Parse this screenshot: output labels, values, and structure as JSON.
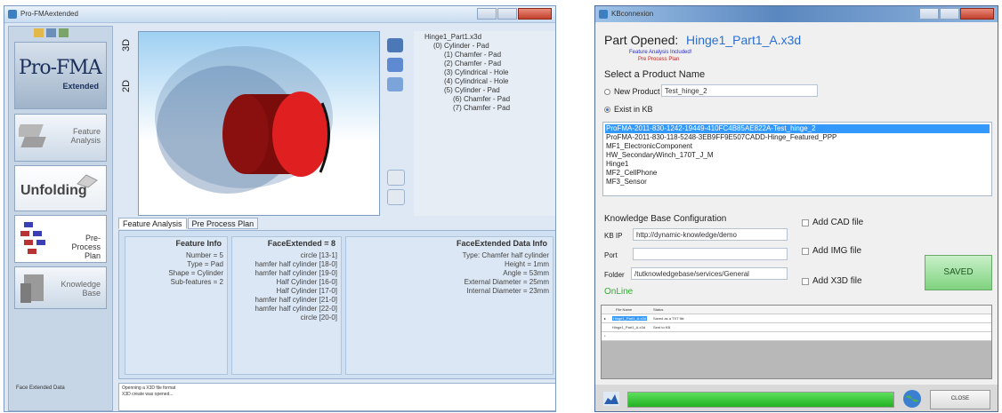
{
  "left_window": {
    "title": "Pro-FMAextended",
    "logo_main": "Pro-FMA",
    "logo_sub": "Extended",
    "side_buttons": [
      {
        "label": "Feature Analysis"
      },
      {
        "label": "Unfolding"
      },
      {
        "label": "Pre-Process Plan"
      },
      {
        "label": "Knowledge Base"
      }
    ],
    "side_status": "Face Extended Data",
    "view_tabs": [
      "3D",
      "2D"
    ],
    "tree": [
      "Hinge1_Part1.x3d",
      "(0) Cylinder - Pad",
      "(1) Chamfer - Pad",
      "(2) Chamfer - Pad",
      "(3) Cylindrical - Hole",
      "(4) Cylindrical - Hole",
      "(5) Cylinder - Pad",
      "(6) Chamfer - Pad",
      "(7) Chamfer - Pad"
    ],
    "tabs": [
      "Feature Analysis",
      "Pre Process Plan"
    ],
    "feature_info": {
      "header": "Feature Info",
      "lines": [
        "Number = 5",
        "Type = Pad",
        "Shape = Cylinder",
        "Sub-features = 2"
      ]
    },
    "face_extended": {
      "header": "FaceExtended = 8",
      "lines": [
        "circle [13-1]",
        "hamfer half cylinder [18-0]",
        "hamfer half cylinder [19-0]",
        "Half Cylinder [16-0]",
        "Half Cylinder [17-0]",
        "hamfer half cylinder [21-0]",
        "hamfer half cylinder [22-0]",
        "circle [20-0]"
      ]
    },
    "face_data": {
      "header": "FaceExtended Data Info",
      "lines": [
        "Type: Chamfer half cylinder",
        "Height = 1mm",
        "Angle = 53mm",
        "External Diameter = 25mm",
        "Internal Diameter = 23mm"
      ]
    },
    "log": [
      "Openning a X3D file format",
      "X3D create was opened..."
    ]
  },
  "right_window": {
    "title": "KBconnexion",
    "part_opened_label": "Part Opened:",
    "part_opened_value": "Hinge1_Part1_A.x3d",
    "note_feature": "Feature Analysis Included!",
    "note_plan": "Pre Process Plan",
    "select_label": "Select a Product Name",
    "new_product_label": "New Product",
    "new_product_value": "Test_hinge_2",
    "exist_label": "Exist in KB",
    "kb_items": [
      "ProFMA-2011-830-1242-19449-410FC4B85AE822A-Test_hinge_2",
      "ProFMA-2011-830-118-5248-3EB9FF9E507CADD-Hinge_Featured_PPP",
      "MF1_ElectronicComponent",
      "HW_SecondaryWinch_170T_J_M",
      "Hinge1",
      "MF2_CellPhone",
      "MF3_Sensor"
    ],
    "kb_config_label": "Knowledge Base Configuration",
    "kbip_label": "KB IP",
    "kbip_value": "http://dynamic-knowledge/demo",
    "port_label": "Port",
    "port_value": "",
    "folder_label": "Folder",
    "folder_value": "/tutknowledgebase/services/General",
    "online_label": "OnLine",
    "chk_cad": "Add CAD file",
    "chk_img": "Add IMG file",
    "chk_x3d": "Add X3D file",
    "saved_button": "SAVED",
    "grid_headers": [
      "File Name",
      "Status"
    ],
    "grid_rows": [
      {
        "file": "Hinge1_Part1_A.x3d",
        "status": "Saved as a TXT file"
      },
      {
        "file": "Hinge1_Part1_A.x3d",
        "status": "Sent to KB"
      }
    ],
    "close_button": "CLOSE"
  }
}
